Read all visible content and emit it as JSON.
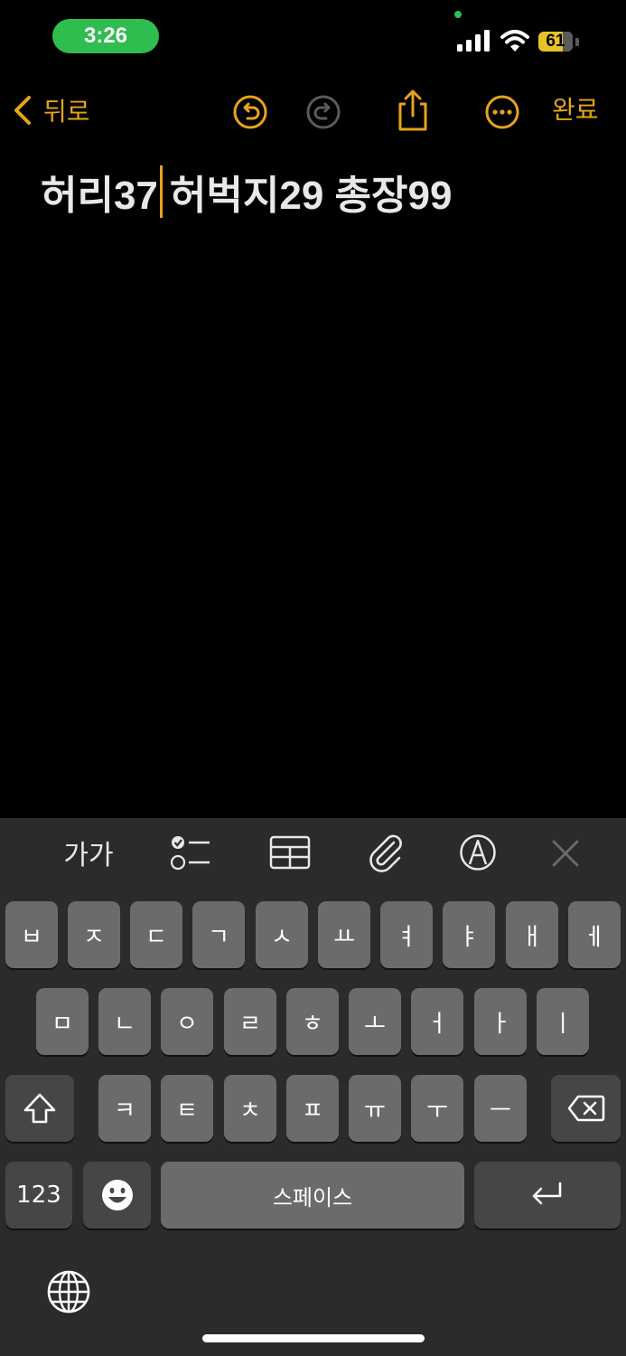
{
  "status_bar": {
    "time": "3:26",
    "battery": "61"
  },
  "nav": {
    "back_label": "뒤로",
    "done_label": "완료"
  },
  "note": {
    "before_caret": "허리37",
    "after_caret": "허벅지29 총장99"
  },
  "toolbar": {
    "text_style_label": "가가"
  },
  "keyboard": {
    "row1": [
      "ㅂ",
      "ㅈ",
      "ㄷ",
      "ㄱ",
      "ㅅ",
      "ㅛ",
      "ㅕ",
      "ㅑ",
      "ㅐ",
      "ㅔ"
    ],
    "row2": [
      "ㅁ",
      "ㄴ",
      "ㅇ",
      "ㄹ",
      "ㅎ",
      "ㅗ",
      "ㅓ",
      "ㅏ",
      "ㅣ"
    ],
    "row3": [
      "ㅋ",
      "ㅌ",
      "ㅊ",
      "ㅍ",
      "ㅠ",
      "ㅜ",
      "ㅡ"
    ],
    "numbers_label": "123",
    "space_label": "스페이스"
  },
  "colors": {
    "accent": "#e7a418",
    "keyboard_bg": "#2b2b2b",
    "key": "#6b6b6b",
    "key_dark": "#464646",
    "time_pill": "#2fbd4f"
  }
}
